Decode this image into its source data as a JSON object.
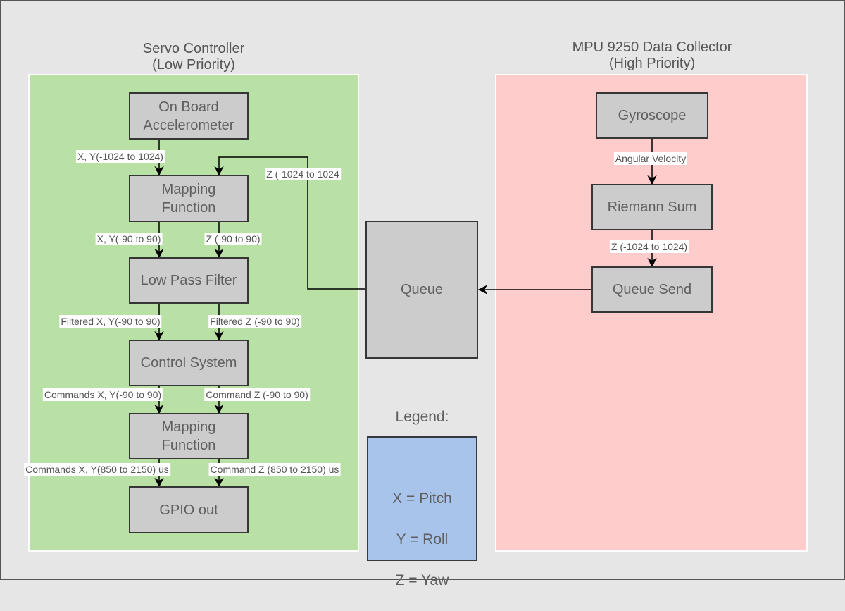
{
  "groups": {
    "servo": {
      "title": "Servo Controller\n(Low Priority)",
      "color": "#b9e0a5"
    },
    "mpu": {
      "title": "MPU 9250 Data Collector\n(High Priority)",
      "color": "#ffcccc"
    }
  },
  "nodes": {
    "accelerometer": "On Board\nAccelerometer",
    "mapping1": "Mapping\nFunction",
    "low_pass": "Low Pass Filter",
    "control": "Control System",
    "mapping2": "Mapping\nFunction",
    "gpio": "GPIO out",
    "gyroscope": "Gyroscope",
    "riemann": "Riemann Sum",
    "queue_send": "Queue Send",
    "queue": "Queue"
  },
  "edge_labels": {
    "accel_xy": "X, Y(-1024 to 1024)",
    "queue_z": "Z (-1024 to 1024",
    "map1_xy": "X, Y(-90 to 90)",
    "map1_z": "Z (-90 to 90)",
    "lpf_xy": "Filtered X, Y(-90 to 90)",
    "lpf_z": "Filtered Z (-90 to 90)",
    "ctrl_xy": "Commands X, Y(-90 to 90)",
    "ctrl_z": "Command Z (-90 to 90)",
    "map2_xy": "Commands X, Y(850 to 2150) us",
    "map2_z": "Command Z (850 to 2150) us",
    "gyro_out": "Angular Velocity",
    "riemann_out": "Z (-1024 to 1024)"
  },
  "legend": {
    "title": "Legend:",
    "x": "X = Pitch",
    "y": "Y = Roll",
    "z": "Z = Yaw",
    "color": "#a9c4eb"
  },
  "node_color": "#cccccc"
}
